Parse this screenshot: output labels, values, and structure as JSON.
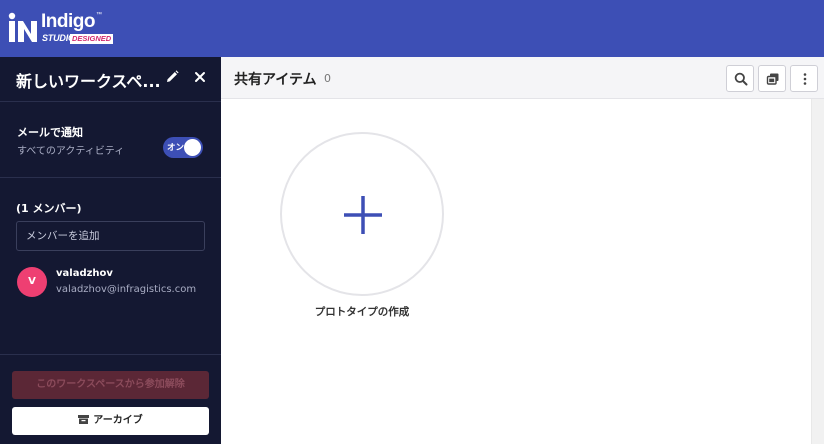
{
  "app": {
    "brand": "Indigo",
    "tm": "™",
    "studio": "STUDIO",
    "designed": "DESIGNED"
  },
  "sidebar": {
    "title": "新しいワークスペ...",
    "notification": {
      "title": "メールで通知",
      "subtitle": "すべてのアクティビティ",
      "toggle_label": "オン",
      "toggle_on": true
    },
    "members": {
      "title": "(1 メンバー)",
      "add_placeholder": "メンバーを追加",
      "list": [
        {
          "initial": "V",
          "name": "valadzhov",
          "email": "valadzhov@infragistics.com",
          "avatar_color": "#ee3f72"
        }
      ]
    },
    "leave_button": "このワークスペースから参加解除",
    "archive_button": "アーカイブ"
  },
  "main": {
    "title": "共有アイテム",
    "count": "0",
    "create_label": "プロトタイプの作成"
  },
  "colors": {
    "topbar": "#3d4fb5",
    "sidebar": "#141832",
    "accent": "#3d4fb5",
    "avatar": "#ee3f72",
    "leave_button_bg": "#5b2736"
  },
  "icons": [
    "indigo-logo-icon",
    "pencil-icon",
    "close-icon",
    "archive-icon",
    "search-icon",
    "copy-icon",
    "more-vertical-icon",
    "plus-icon"
  ]
}
